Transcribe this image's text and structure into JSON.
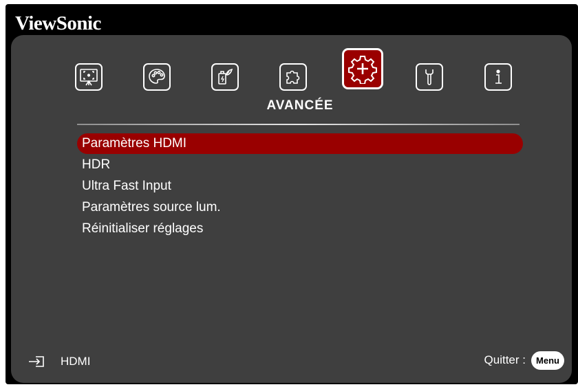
{
  "brand": {
    "logo_text": "ViewSonic"
  },
  "tabs": [
    {
      "name": "display",
      "icon": "display-icon",
      "active": false
    },
    {
      "name": "image",
      "icon": "palette-icon",
      "active": false
    },
    {
      "name": "power",
      "icon": "power-management-icon",
      "active": false
    },
    {
      "name": "basic",
      "icon": "puzzle-icon",
      "active": false
    },
    {
      "name": "advanced",
      "icon": "gear-plus-icon",
      "active": true
    },
    {
      "name": "system",
      "icon": "wrench-icon",
      "active": false
    },
    {
      "name": "information",
      "icon": "info-icon",
      "active": false
    }
  ],
  "menu": {
    "title": "AVANCÉE",
    "items": [
      {
        "label": "Paramètres HDMI",
        "selected": true
      },
      {
        "label": "HDR",
        "selected": false
      },
      {
        "label": "Ultra Fast Input",
        "selected": false
      },
      {
        "label": "Paramètres source lum.",
        "selected": false
      },
      {
        "label": "Réinitialiser réglages",
        "selected": false
      }
    ]
  },
  "footer": {
    "source_icon": "input-source-icon",
    "source_label": "HDMI",
    "exit_label": "Quitter :",
    "exit_key": "Menu"
  },
  "colors": {
    "panel_bg": "#3f3f3f",
    "highlight": "#990000",
    "text": "#ffffff"
  }
}
